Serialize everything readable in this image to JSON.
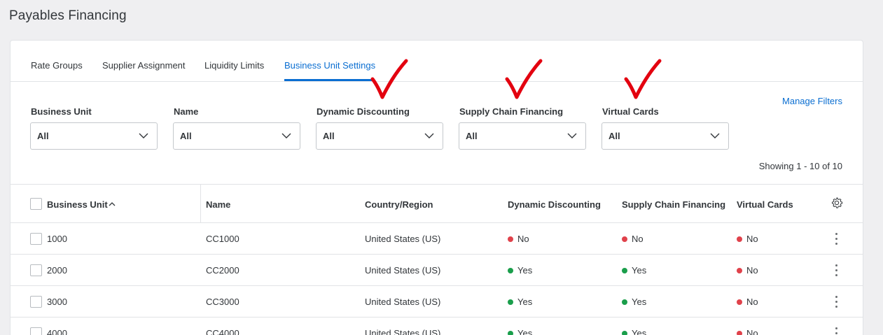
{
  "page": {
    "title": "Payables Financing"
  },
  "tabs": [
    {
      "label": "Rate Groups"
    },
    {
      "label": "Supplier Assignment"
    },
    {
      "label": "Liquidity Limits"
    },
    {
      "label": "Business Unit Settings",
      "active": true
    }
  ],
  "filters": [
    {
      "label": "Business Unit",
      "value": "All"
    },
    {
      "label": "Name",
      "value": "All"
    },
    {
      "label": "Dynamic Discounting",
      "value": "All"
    },
    {
      "label": "Supply Chain Financing",
      "value": "All"
    },
    {
      "label": "Virtual Cards",
      "value": "All"
    }
  ],
  "manage_filters_label": "Manage Filters",
  "showing_text": "Showing 1 - 10 of 10",
  "table": {
    "columns": [
      "Business Unit",
      "Name",
      "Country/Region",
      "Dynamic Discounting",
      "Supply Chain Financing",
      "Virtual Cards"
    ],
    "rows": [
      {
        "bu": "1000",
        "name": "CC1000",
        "country": "United States (US)",
        "dd": "No",
        "scf": "No",
        "vc": "No"
      },
      {
        "bu": "2000",
        "name": "CC2000",
        "country": "United States (US)",
        "dd": "Yes",
        "scf": "Yes",
        "vc": "No"
      },
      {
        "bu": "3000",
        "name": "CC3000",
        "country": "United States (US)",
        "dd": "Yes",
        "scf": "Yes",
        "vc": "No"
      },
      {
        "bu": "4000",
        "name": "CC4000",
        "country": "United States (US)",
        "dd": "Yes",
        "scf": "Yes",
        "vc": "No"
      }
    ]
  },
  "colors": {
    "accent": "#0a6ed1",
    "yes": "#1a9e4b",
    "no": "#e0424b",
    "annotation": "#e3000f"
  },
  "icons": [
    "chevron-down-icon",
    "sort-ascending-icon",
    "gear-icon",
    "more-vertical-icon",
    "annotation-checkmark"
  ]
}
